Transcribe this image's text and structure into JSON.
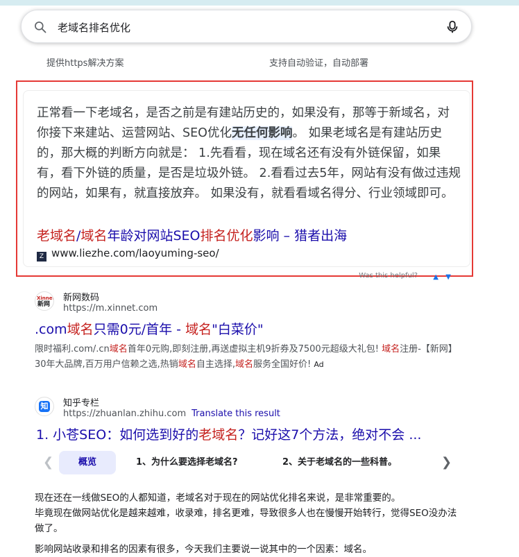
{
  "search": {
    "query": "老域名排名优化"
  },
  "faded_top": {
    "left_sub": "提供https解决方案",
    "right_sub": "支持自动验证，自动部署"
  },
  "featured": {
    "snippet_part1": "正常看一下老域名，是否之前是有建站历史的，如果没有，那等于新域名，对你接下来建站、运营网站、SEO优化",
    "snippet_bold": "无任何影响",
    "snippet_part2": "。 如果老域名是有建站历史的，那大概的判断方向就是： 1.先看看，现在域名还有没有外链保留，如果有，看下外链的质量，是否是垃圾外链。 2.看看过去5年，网站有没有做过违规的网站，如果有，就直接放弃。 如果没有，就看看域名得分、行业领域即可。",
    "title_hl1": "老域名",
    "title_sep": "/",
    "title_hl2": "域名",
    "title_mid": "年龄对网站SEO",
    "title_hl3": "排名优化",
    "title_end": "影响 – 猎者出海",
    "url": "www.liezhe.com/laoyuming-seo/",
    "favicon_text": "Z",
    "helpful": "Was this helpful?"
  },
  "results": [
    {
      "site": "新网数码",
      "url": "https://m.xinnet.com",
      "favicon_text": "Xinnet\n新网",
      "title_a": ".com",
      "title_b": "域名",
      "title_c": "只需0元/首年 - ",
      "title_d": "域名",
      "title_e": "\"白菜价\"",
      "desc_a": "限时福利.com/.cn",
      "desc_b": "域名",
      "desc_c": "首年0元购,即刻注册,再送虚拟主机9折券及7500元超级大礼包! ",
      "desc_d": "域名",
      "desc_e": "注册-【新网】30年大品牌,百万用户信赖之选,热销",
      "desc_f": "域名",
      "desc_g": "自主选择,",
      "desc_h": "域名",
      "desc_i": "服务全国好价! ",
      "ad": "Ad"
    },
    {
      "site": "知乎专栏",
      "url": "https://zhuanlan.zhihu.com",
      "translate": "Translate this result",
      "favicon_text": "知",
      "title_a": "1. 小苍SEO：如何选到好的",
      "title_b": "老域名",
      "title_c": "？记好这7个方法，绝对不会 ...",
      "tabs": [
        "概览",
        "1、为什么要选择老域名?",
        "2、关于老域名的一些科普。"
      ],
      "para1": "现在还在一线做SEO的人都知道，老域名对于现在的网站优化排名来说，是非常重要的。",
      "para2": "毕竟现在做网站优化是越来越难，收录难，排名更难，导致很多人也在慢慢开始转行，觉得SEO没办法做了。",
      "para3": "影响网站收录和排名的因素有很多，今天我们主要说一说其中的一个因素：域名。"
    }
  ],
  "colors": {
    "link": "#1a0dab",
    "highlight": "#c5221f",
    "frame": "#e53935"
  }
}
